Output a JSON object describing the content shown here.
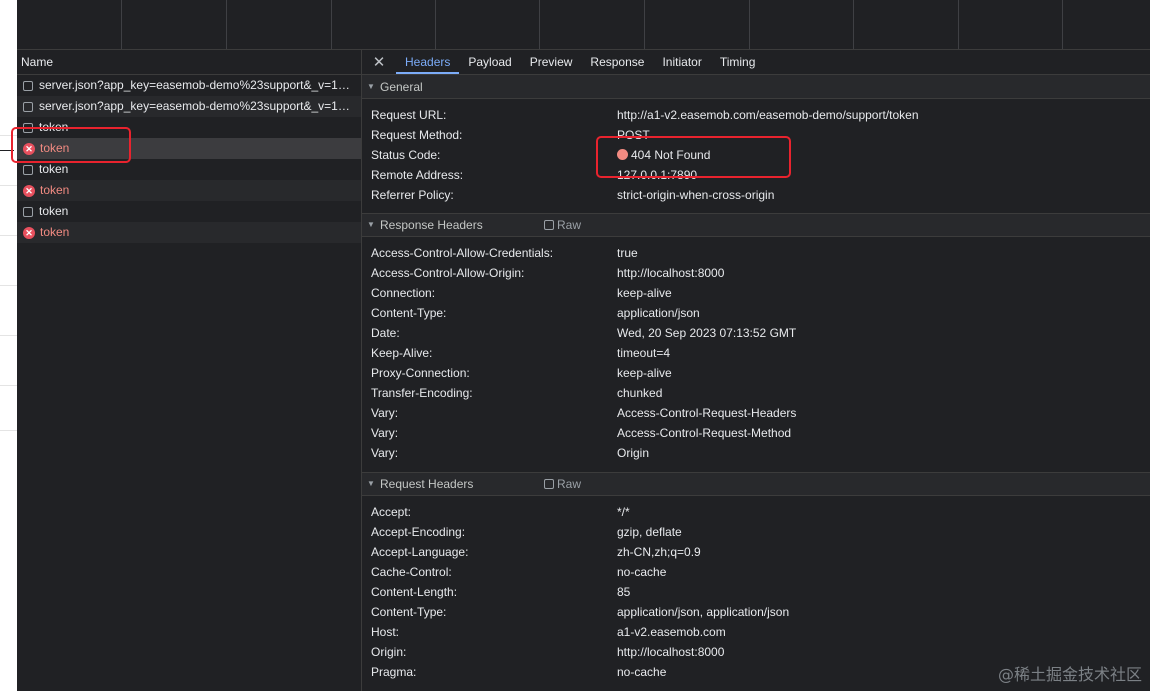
{
  "name_column": {
    "header": "Name"
  },
  "requests": [
    {
      "label": "server.json?app_key=easemob-demo%23support&_v=1…",
      "state": "ok"
    },
    {
      "label": "server.json?app_key=easemob-demo%23support&_v=1…",
      "state": "ok"
    },
    {
      "label": "token",
      "state": "ok"
    },
    {
      "label": "token",
      "state": "error"
    },
    {
      "label": "token",
      "state": "ok"
    },
    {
      "label": "token",
      "state": "error"
    },
    {
      "label": "token",
      "state": "ok"
    },
    {
      "label": "token",
      "state": "error"
    }
  ],
  "tabs": [
    "Headers",
    "Payload",
    "Preview",
    "Response",
    "Initiator",
    "Timing"
  ],
  "active_tab": "Headers",
  "general": {
    "title": "General",
    "rows": [
      {
        "k": "Request URL:",
        "v": "http://a1-v2.easemob.com/easemob-demo/support/token"
      },
      {
        "k": "Request Method:",
        "v": "POST"
      },
      {
        "k": "Status Code:",
        "v": "404 Not Found"
      },
      {
        "k": "Remote Address:",
        "v": "127.0.0.1:7890"
      },
      {
        "k": "Referrer Policy:",
        "v": "strict-origin-when-cross-origin"
      }
    ]
  },
  "response_headers": {
    "title": "Response Headers",
    "raw_label": "Raw",
    "rows": [
      {
        "k": "Access-Control-Allow-Credentials:",
        "v": "true"
      },
      {
        "k": "Access-Control-Allow-Origin:",
        "v": "http://localhost:8000"
      },
      {
        "k": "Connection:",
        "v": "keep-alive"
      },
      {
        "k": "Content-Type:",
        "v": "application/json"
      },
      {
        "k": "Date:",
        "v": "Wed, 20 Sep 2023 07:13:52 GMT"
      },
      {
        "k": "Keep-Alive:",
        "v": "timeout=4"
      },
      {
        "k": "Proxy-Connection:",
        "v": "keep-alive"
      },
      {
        "k": "Transfer-Encoding:",
        "v": "chunked"
      },
      {
        "k": "Vary:",
        "v": "Access-Control-Request-Headers"
      },
      {
        "k": "Vary:",
        "v": "Access-Control-Request-Method"
      },
      {
        "k": "Vary:",
        "v": "Origin"
      }
    ]
  },
  "request_headers": {
    "title": "Request Headers",
    "raw_label": "Raw",
    "rows": [
      {
        "k": "Accept:",
        "v": "*/*"
      },
      {
        "k": "Accept-Encoding:",
        "v": "gzip, deflate"
      },
      {
        "k": "Accept-Language:",
        "v": "zh-CN,zh;q=0.9"
      },
      {
        "k": "Cache-Control:",
        "v": "no-cache"
      },
      {
        "k": "Content-Length:",
        "v": "85"
      },
      {
        "k": "Content-Type:",
        "v": "application/json, application/json"
      },
      {
        "k": "Host:",
        "v": "a1-v2.easemob.com"
      },
      {
        "k": "Origin:",
        "v": "http://localhost:8000"
      },
      {
        "k": "Pragma:",
        "v": "no-cache"
      }
    ]
  },
  "watermark": "@稀土掘金技术社区",
  "colors": {
    "accent": "#7cacf8",
    "error": "#f28b82",
    "annotation": "#e8232e"
  }
}
